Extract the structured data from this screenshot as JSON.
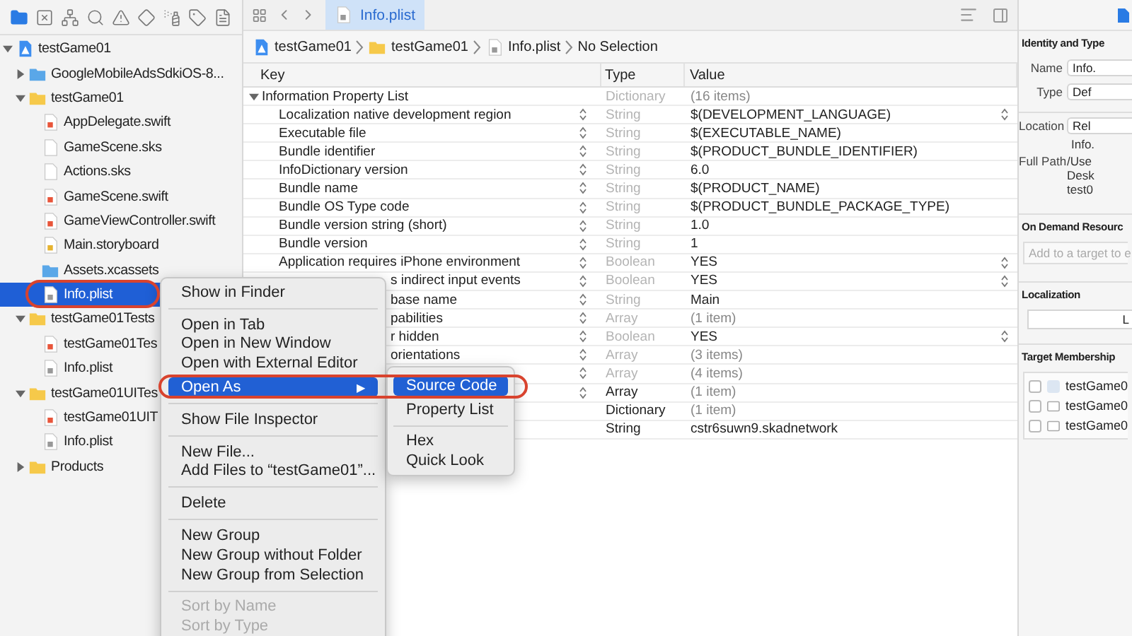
{
  "navigator_tabs": [
    {
      "selected": true
    },
    {
      "selected": false
    },
    {
      "selected": false
    },
    {
      "selected": false
    },
    {
      "selected": false
    },
    {
      "selected": false
    },
    {
      "selected": false
    },
    {
      "selected": false
    },
    {
      "selected": false
    }
  ],
  "tree": [
    {
      "name": "testGame01",
      "kind": "project",
      "expanded": true,
      "selected": false,
      "children": [
        {
          "name": "GoogleMobileAdsSdkiOS-8...",
          "kind": "group",
          "expanded": false,
          "selected": false
        },
        {
          "name": "testGame01",
          "kind": "folder",
          "expanded": true,
          "selected": false,
          "children": [
            {
              "name": "AppDelegate.swift",
              "kind": "swift",
              "selected": false
            },
            {
              "name": "GameScene.sks",
              "kind": "file",
              "selected": false
            },
            {
              "name": "Actions.sks",
              "kind": "file",
              "selected": false
            },
            {
              "name": "GameScene.swift",
              "kind": "swift",
              "selected": false
            },
            {
              "name": "GameViewController.swift",
              "kind": "swift",
              "selected": false
            },
            {
              "name": "Main.storyboard",
              "kind": "storyboard",
              "selected": false
            },
            {
              "name": "Assets.xcassets",
              "kind": "assets",
              "selected": false
            },
            {
              "name": "Info.plist",
              "kind": "plist",
              "selected": true
            }
          ]
        },
        {
          "name": "testGame01Tests",
          "kind": "folder",
          "expanded": true,
          "selected": false,
          "children": [
            {
              "name": "testGame01Tes",
              "kind": "swift",
              "selected": false
            },
            {
              "name": "Info.plist",
              "kind": "plist",
              "selected": false
            }
          ]
        },
        {
          "name": "testGame01UITes",
          "kind": "folder",
          "expanded": true,
          "selected": false,
          "children": [
            {
              "name": "testGame01UIT",
              "kind": "swift",
              "selected": false
            },
            {
              "name": "Info.plist",
              "kind": "plist",
              "selected": false
            }
          ]
        },
        {
          "name": "Products",
          "kind": "folder",
          "expanded": false,
          "selected": false
        }
      ]
    }
  ],
  "editor_tab": {
    "label": "Info.plist",
    "selected": true
  },
  "breadcrumb": [
    {
      "label": "testGame01",
      "kind": "project"
    },
    {
      "label": "testGame01",
      "kind": "folder"
    },
    {
      "label": "Info.plist",
      "kind": "plist"
    },
    {
      "label": "No Selection",
      "kind": "text"
    }
  ],
  "columns": [
    "Key",
    "Type",
    "Value"
  ],
  "rows": [
    {
      "key": "Information Property List",
      "expanded": true,
      "type": "Dictionary",
      "type_muted": true,
      "value": "(16 items)",
      "value_muted": true,
      "key_stepper": false,
      "value_popup": false
    },
    {
      "key": "Localization native development region",
      "type": "String",
      "type_muted": true,
      "value": "$(DEVELOPMENT_LANGUAGE)",
      "value_muted": false,
      "key_stepper": true,
      "value_popup": true
    },
    {
      "key": "Executable file",
      "type": "String",
      "type_muted": true,
      "value": "$(EXECUTABLE_NAME)",
      "value_muted": false,
      "key_stepper": true,
      "value_popup": false
    },
    {
      "key": "Bundle identifier",
      "type": "String",
      "type_muted": true,
      "value": "$(PRODUCT_BUNDLE_IDENTIFIER)",
      "value_muted": false,
      "key_stepper": true,
      "value_popup": false
    },
    {
      "key": "InfoDictionary version",
      "type": "String",
      "type_muted": true,
      "value": "6.0",
      "value_muted": false,
      "key_stepper": true,
      "value_popup": false
    },
    {
      "key": "Bundle name",
      "type": "String",
      "type_muted": true,
      "value": "$(PRODUCT_NAME)",
      "value_muted": false,
      "key_stepper": true,
      "value_popup": false
    },
    {
      "key": "Bundle OS Type code",
      "type": "String",
      "type_muted": true,
      "value": "$(PRODUCT_BUNDLE_PACKAGE_TYPE)",
      "value_muted": false,
      "key_stepper": true,
      "value_popup": false
    },
    {
      "key": "Bundle version string (short)",
      "type": "String",
      "type_muted": true,
      "value": "1.0",
      "value_muted": false,
      "key_stepper": true,
      "value_popup": false
    },
    {
      "key": "Bundle version",
      "type": "String",
      "type_muted": true,
      "value": "1",
      "value_muted": false,
      "key_stepper": true,
      "value_popup": false
    },
    {
      "key": "Application requires iPhone environment",
      "type": "Boolean",
      "type_muted": true,
      "value": "YES",
      "value_muted": false,
      "key_stepper": true,
      "value_popup": true
    },
    {
      "key": "s indirect input events",
      "type": "Boolean",
      "type_muted": true,
      "value": "YES",
      "value_muted": false,
      "key_stepper": true,
      "value_popup": true
    },
    {
      "key": "base name",
      "type": "String",
      "type_muted": true,
      "value": "Main",
      "value_muted": false,
      "key_stepper": true,
      "value_popup": false
    },
    {
      "key": "pabilities",
      "type": "Array",
      "type_muted": true,
      "value": "(1 item)",
      "value_muted": true,
      "key_stepper": true,
      "value_popup": false
    },
    {
      "key": "r hidden",
      "type": "Boolean",
      "type_muted": true,
      "value": "YES",
      "value_muted": false,
      "key_stepper": true,
      "value_popup": true
    },
    {
      "key": "orientations",
      "type": "Array",
      "type_muted": true,
      "value": "(3 items)",
      "value_muted": true,
      "key_stepper": true,
      "value_popup": false
    },
    {
      "type": "Array",
      "type_muted": true,
      "value": "(4 items)",
      "value_muted": true,
      "key_stepper": true,
      "value_popup": false
    },
    {
      "type": "Array",
      "type_muted": false,
      "value": "(1 item)",
      "value_muted": true,
      "key_stepper": true,
      "value_popup": false
    },
    {
      "type": "Dictionary",
      "type_muted": false,
      "value": "(1 item)",
      "value_muted": true,
      "key_stepper": false,
      "value_popup": false
    },
    {
      "type": "String",
      "type_muted": false,
      "value": "cstr6suwn9.skadnetwork",
      "value_muted": false,
      "key_stepper": false,
      "value_popup": false
    }
  ],
  "inspector": {
    "identity_title": "Identity and Type",
    "fields": [
      {
        "label": "Name",
        "value": "Info."
      },
      {
        "label": "Type",
        "value": "Def"
      },
      {
        "label": "Location",
        "value": "Rel"
      }
    ],
    "location_file": "Info.",
    "full_path_label": "Full Path",
    "full_path": [
      "/Use",
      "Desk",
      "test0"
    ],
    "on_demand_title": "On Demand Resourc",
    "on_demand_placeholder": "Add to a target to e",
    "localization_title": "Localization",
    "localization_button": "L",
    "membership_title": "Target Membership",
    "targets": [
      {
        "name": "testGame0",
        "kind": "app",
        "checked": false
      },
      {
        "name": "testGame0",
        "kind": "box",
        "checked": false
      },
      {
        "name": "testGame0",
        "kind": "box",
        "checked": false
      }
    ]
  },
  "context_menu": [
    {
      "kind": "item",
      "label": "Show in Finder",
      "disabled": false,
      "selected": false
    },
    {
      "kind": "separator"
    },
    {
      "kind": "item",
      "label": "Open in Tab",
      "disabled": false,
      "selected": false
    },
    {
      "kind": "item",
      "label": "Open in New Window",
      "disabled": false,
      "selected": false
    },
    {
      "kind": "item",
      "label": "Open with External Editor",
      "disabled": false,
      "selected": false
    },
    {
      "kind": "item",
      "label": "Open As",
      "arrow": "▶",
      "disabled": false,
      "selected": true
    },
    {
      "kind": "separator"
    },
    {
      "kind": "item",
      "label": "Show File Inspector",
      "disabled": false,
      "selected": false
    },
    {
      "kind": "separator"
    },
    {
      "kind": "item",
      "label": "New File...",
      "disabled": false,
      "selected": false
    },
    {
      "kind": "item",
      "label": "Add Files to “testGame01”...",
      "disabled": false,
      "selected": false
    },
    {
      "kind": "separator"
    },
    {
      "kind": "item",
      "label": "Delete",
      "disabled": false,
      "selected": false
    },
    {
      "kind": "separator"
    },
    {
      "kind": "item",
      "label": "New Group",
      "disabled": false,
      "selected": false
    },
    {
      "kind": "item",
      "label": "New Group without Folder",
      "disabled": false,
      "selected": false
    },
    {
      "kind": "item",
      "label": "New Group from Selection",
      "disabled": false,
      "selected": false
    },
    {
      "kind": "separator"
    },
    {
      "kind": "item",
      "label": "Sort by Name",
      "disabled": true,
      "selected": false
    },
    {
      "kind": "item",
      "label": "Sort by Type",
      "disabled": true,
      "selected": false
    }
  ],
  "submenu": [
    {
      "kind": "item",
      "label": "Source Code",
      "disabled": false,
      "selected": true
    },
    {
      "kind": "item",
      "label": "Property List",
      "disabled": false,
      "selected": false
    },
    {
      "kind": "separator"
    },
    {
      "kind": "item",
      "label": "Hex",
      "disabled": false,
      "selected": false
    },
    {
      "kind": "item",
      "label": "Quick Look",
      "disabled": false,
      "selected": false
    }
  ]
}
